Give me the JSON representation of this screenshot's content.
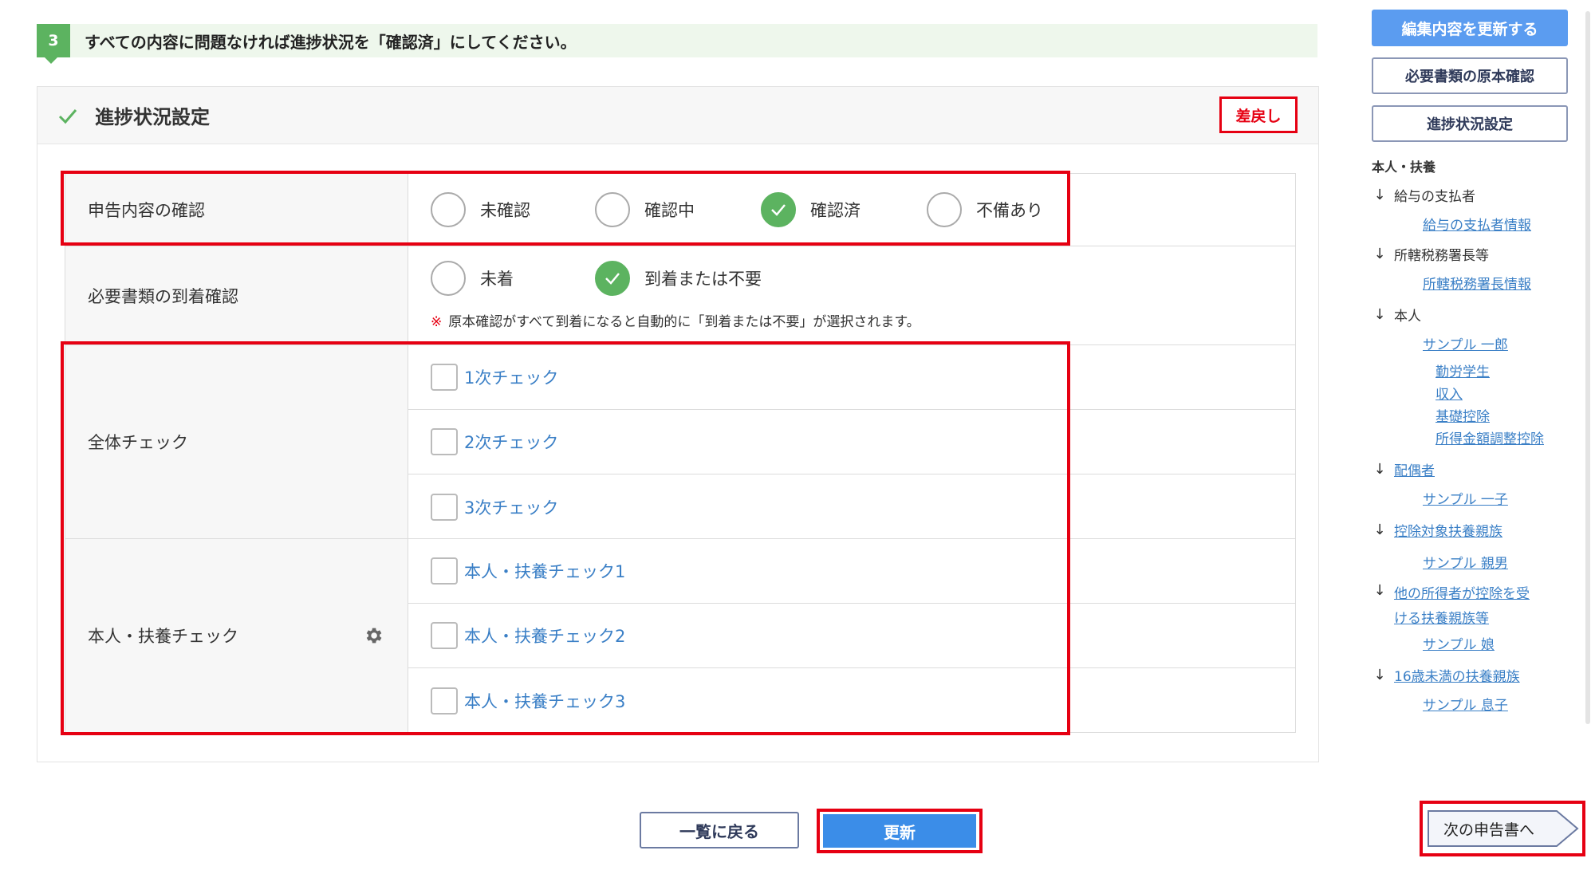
{
  "step": {
    "number": "3",
    "text": "すべての内容に問題なければ進捗状況を「確認済」にしてください。"
  },
  "panel": {
    "title": "進捗状況設定",
    "return_label": "差戻し"
  },
  "declaration_check": {
    "label": "申告内容の確認",
    "options": [
      "未確認",
      "確認中",
      "確認済",
      "不備あり"
    ],
    "selected": "確認済"
  },
  "documents_arrival": {
    "label": "必要書類の到着確認",
    "options": [
      "未着",
      "到着または不要"
    ],
    "selected": "到着または不要",
    "note_mark": "※",
    "note": "原本確認がすべて到着になると自動的に「到着または不要」が選択されます。"
  },
  "overall_check": {
    "label": "全体チェック",
    "items": [
      "1次チェック",
      "2次チェック",
      "3次チェック"
    ]
  },
  "person_check": {
    "label": "本人・扶養チェック",
    "items": [
      "本人・扶養チェック1",
      "本人・扶養チェック2",
      "本人・扶養チェック3"
    ]
  },
  "buttons": {
    "back": "一覧に戻る",
    "update": "更新"
  },
  "sidebar": {
    "update_edit": "編集内容を更新する",
    "original_docs": "必要書類の原本確認",
    "progress": "進捗状況設定",
    "heading": "本人・扶養",
    "groups": [
      {
        "label": "給与の支払者",
        "links": [
          "給与の支払者情報"
        ]
      },
      {
        "label": "所轄税務署長等",
        "links": [
          "所轄税務署長情報"
        ]
      },
      {
        "label": "本人",
        "links": [
          "サンプル 一郎"
        ],
        "sublinks": [
          "勤労学生",
          "収入",
          "基礎控除",
          "所得金額調整控除"
        ]
      },
      {
        "label": "配偶者",
        "links": [
          "サンプル 一子"
        ]
      },
      {
        "label": "控除対象扶養親族",
        "links": [
          "サンプル 親男"
        ]
      },
      {
        "label": "他の所得者が控除を受",
        "label2": "ける扶養親族等",
        "links": [
          "サンプル 娘"
        ]
      },
      {
        "label": "16歳未満の扶養親族",
        "links": [
          "サンプル 息子"
        ]
      }
    ],
    "next": "次の申告書へ"
  },
  "colors": {
    "accent_green": "#5cb360",
    "highlight_red": "#e60012",
    "primary_blue": "#3b8de8",
    "link_blue": "#3a7fc6"
  }
}
